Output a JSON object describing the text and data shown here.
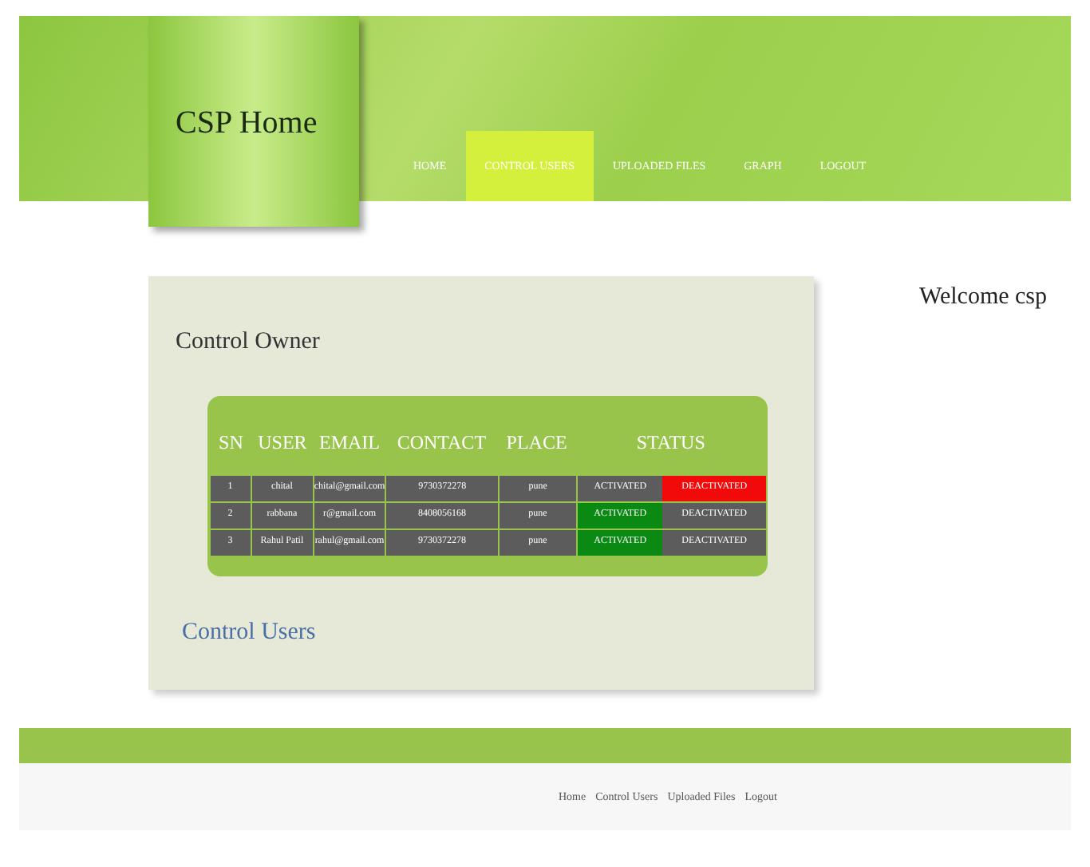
{
  "logo": "CSP Home",
  "nav": [
    {
      "label": "HOME",
      "selected": false
    },
    {
      "label": "CONTROL USERS",
      "selected": true
    },
    {
      "label": "UPLOADED FILES",
      "selected": false
    },
    {
      "label": "GRAPH",
      "selected": false
    },
    {
      "label": "LOGOUT",
      "selected": false
    }
  ],
  "welcome": "Welcome csp",
  "panel_title": "Control Owner",
  "table": {
    "columns": [
      "SN",
      "USER",
      "EMAIL",
      "CONTACT",
      "PLACE",
      "STATUS"
    ],
    "rows": [
      {
        "sn": "1",
        "user": "chital",
        "email": "chital@gmail.com",
        "contact": "9730372278",
        "place": "pune",
        "activate": "ACTIVATED",
        "deactivate": "DEACTIVATED",
        "active": false
      },
      {
        "sn": "2",
        "user": "rabbana",
        "email": "r@gmail.com",
        "contact": "8408056168",
        "place": "pune",
        "activate": "ACTIVATED",
        "deactivate": "DEACTIVATED",
        "active": true
      },
      {
        "sn": "3",
        "user": "Rahul Patil",
        "email": "rahul@gmail.com",
        "contact": "9730372278",
        "place": "pune",
        "activate": "ACTIVATED",
        "deactivate": "DEACTIVATED",
        "active": true
      }
    ]
  },
  "panel_link": "Control Users",
  "footer_links": [
    "Home",
    "Control Users",
    "Uploaded Files",
    "Logout"
  ]
}
